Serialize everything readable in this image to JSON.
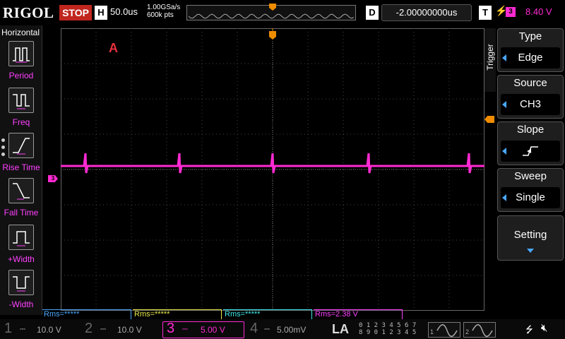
{
  "header": {
    "logo": "RIGOL",
    "run_state": "STOP",
    "h_label": "H",
    "timebase": "50.0us",
    "sample_rate": "1.00GSa/s",
    "memory_depth": "600k pts",
    "d_label": "D",
    "delay": "-2.00000000us",
    "t_label": "T",
    "trigger_channel": "3",
    "trigger_level": "8.40 V"
  },
  "left_panel": {
    "title": "Horizontal",
    "items": [
      {
        "label": "Period",
        "icon": "period-icon"
      },
      {
        "label": "Freq",
        "icon": "frequency-icon"
      },
      {
        "label": "Rise Time",
        "icon": "rise-time-icon"
      },
      {
        "label": "Fall Time",
        "icon": "fall-time-icon"
      },
      {
        "label": "+Width",
        "icon": "positive-width-icon"
      },
      {
        "label": "-Width",
        "icon": "negative-width-icon"
      }
    ]
  },
  "grid": {
    "marker_label": "A",
    "ch3_marker": "3",
    "colors": {
      "trace": "#ff2ad2",
      "grid": "#555555",
      "trigger": "#f08c00"
    }
  },
  "right_panel": {
    "tab": "Trigger",
    "menu": [
      {
        "title": "Type",
        "value": "Edge"
      },
      {
        "title": "Source",
        "value": "CH3"
      },
      {
        "title": "Slope",
        "value": ""
      },
      {
        "title": "Sweep",
        "value": "Single"
      }
    ],
    "setting": "Setting"
  },
  "measurements": [
    {
      "text": "Rms=*****",
      "color": "#4aa8ff"
    },
    {
      "text": "Rms=*****",
      "color": "#e8e84a"
    },
    {
      "text": "Rms=*****",
      "color": "#3ee8e8"
    },
    {
      "text": "Rms=2.38 V",
      "color": "#ff40ff"
    }
  ],
  "channels": [
    {
      "num": "1",
      "scale": "10.0 V"
    },
    {
      "num": "2",
      "scale": "10.0 V"
    },
    {
      "num": "3",
      "scale": "5.00 V"
    },
    {
      "num": "4",
      "scale": "5.00mV"
    }
  ],
  "bottom": {
    "la": "LA",
    "la_row1": "0 1 2 3  4 5 6 7",
    "la_row2": "8 9 0 1  2 3 4 5",
    "gen1": "1",
    "gen2": "2"
  }
}
